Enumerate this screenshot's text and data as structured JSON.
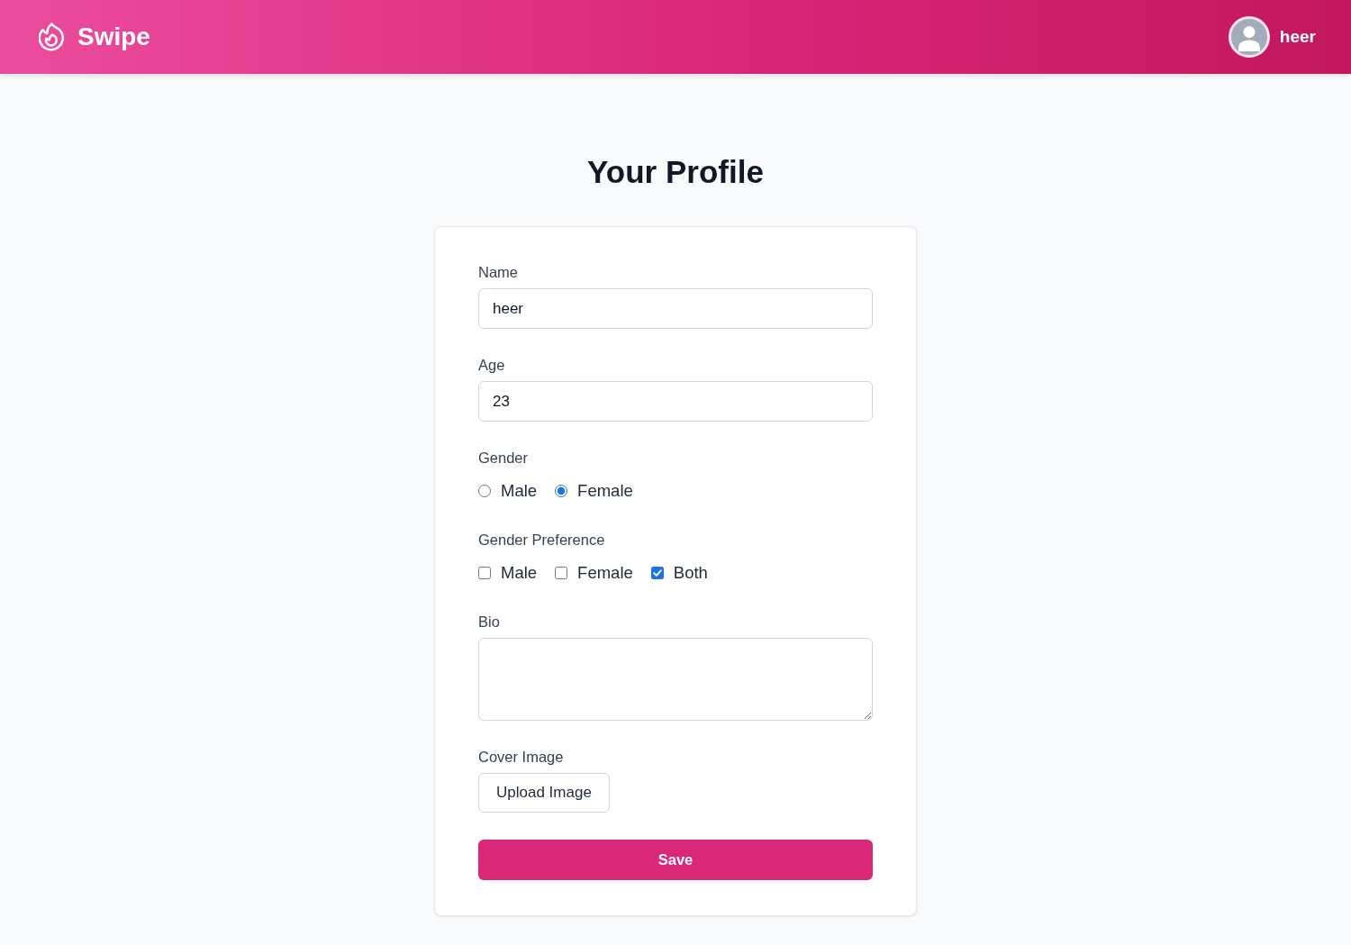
{
  "header": {
    "logo": "Swipe",
    "user_name": "heer"
  },
  "title": "Your Profile",
  "form": {
    "fields": [
      {
        "kind": "text",
        "label": "Name",
        "value": "heer"
      },
      {
        "kind": "text",
        "label": "Age",
        "value": "23"
      },
      {
        "kind": "radio",
        "label": "Gender",
        "options": [
          {
            "label": "Male",
            "selected": false
          },
          {
            "label": "Female",
            "selected": true
          }
        ]
      },
      {
        "kind": "checkbox",
        "label": "Gender Preference",
        "options": [
          {
            "label": "Male",
            "checked": false
          },
          {
            "label": "Female",
            "checked": false
          },
          {
            "label": "Both",
            "checked": true
          }
        ]
      },
      {
        "kind": "textarea",
        "label": "Bio"
      },
      {
        "kind": "upload",
        "label": "Cover Image",
        "button": "Upload Image"
      }
    ],
    "submit": "Save"
  }
}
